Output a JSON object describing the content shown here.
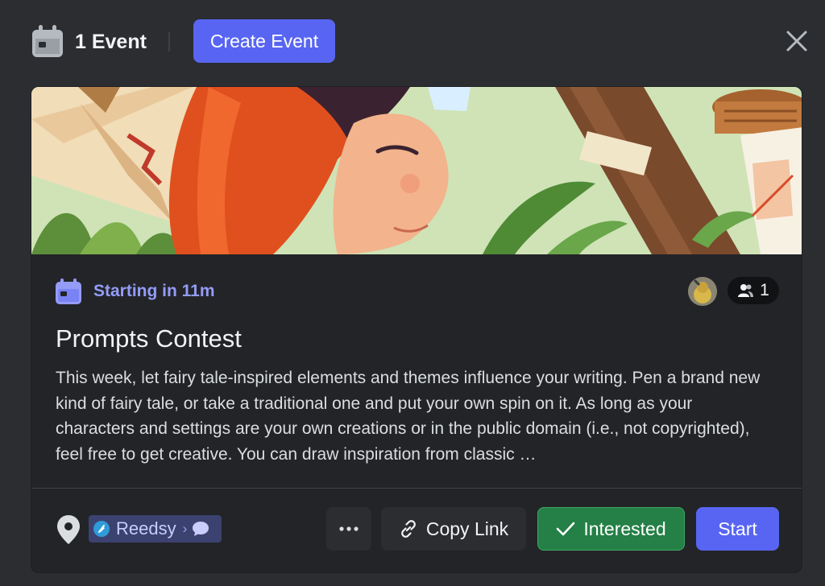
{
  "header": {
    "event_count": "1 Event",
    "create_button": "Create Event"
  },
  "event": {
    "status": "Starting in 11m",
    "attendee_count": "1",
    "title": "Prompts Contest",
    "description": "This week, let fairy tale-inspired elements and themes influence your writing. Pen a brand new kind of fairy tale, or take a traditional one and put your own spin on it. As long as your characters and settings are your own creations or in the public domain (i.e., not copyrighted), feel free to get creative. You can draw inspiration from classic …"
  },
  "footer": {
    "channel_name": "Reedsy",
    "channel_chevron": "›",
    "more_label": "···",
    "copy_link": "Copy Link",
    "interested": "Interested",
    "start": "Start"
  },
  "icons": {
    "header": "calendar-icon",
    "close": "close-icon",
    "status": "calendar-icon",
    "attendees": "people-icon",
    "location": "location-pin-icon",
    "copy": "link-icon",
    "interested": "checkmark-icon",
    "thread": "speech-bubble-icon"
  },
  "colors": {
    "accent": "#5865f2",
    "status_text": "#949cf7",
    "interested_green": "#248046",
    "background": "#2b2d31",
    "card": "#232428"
  }
}
